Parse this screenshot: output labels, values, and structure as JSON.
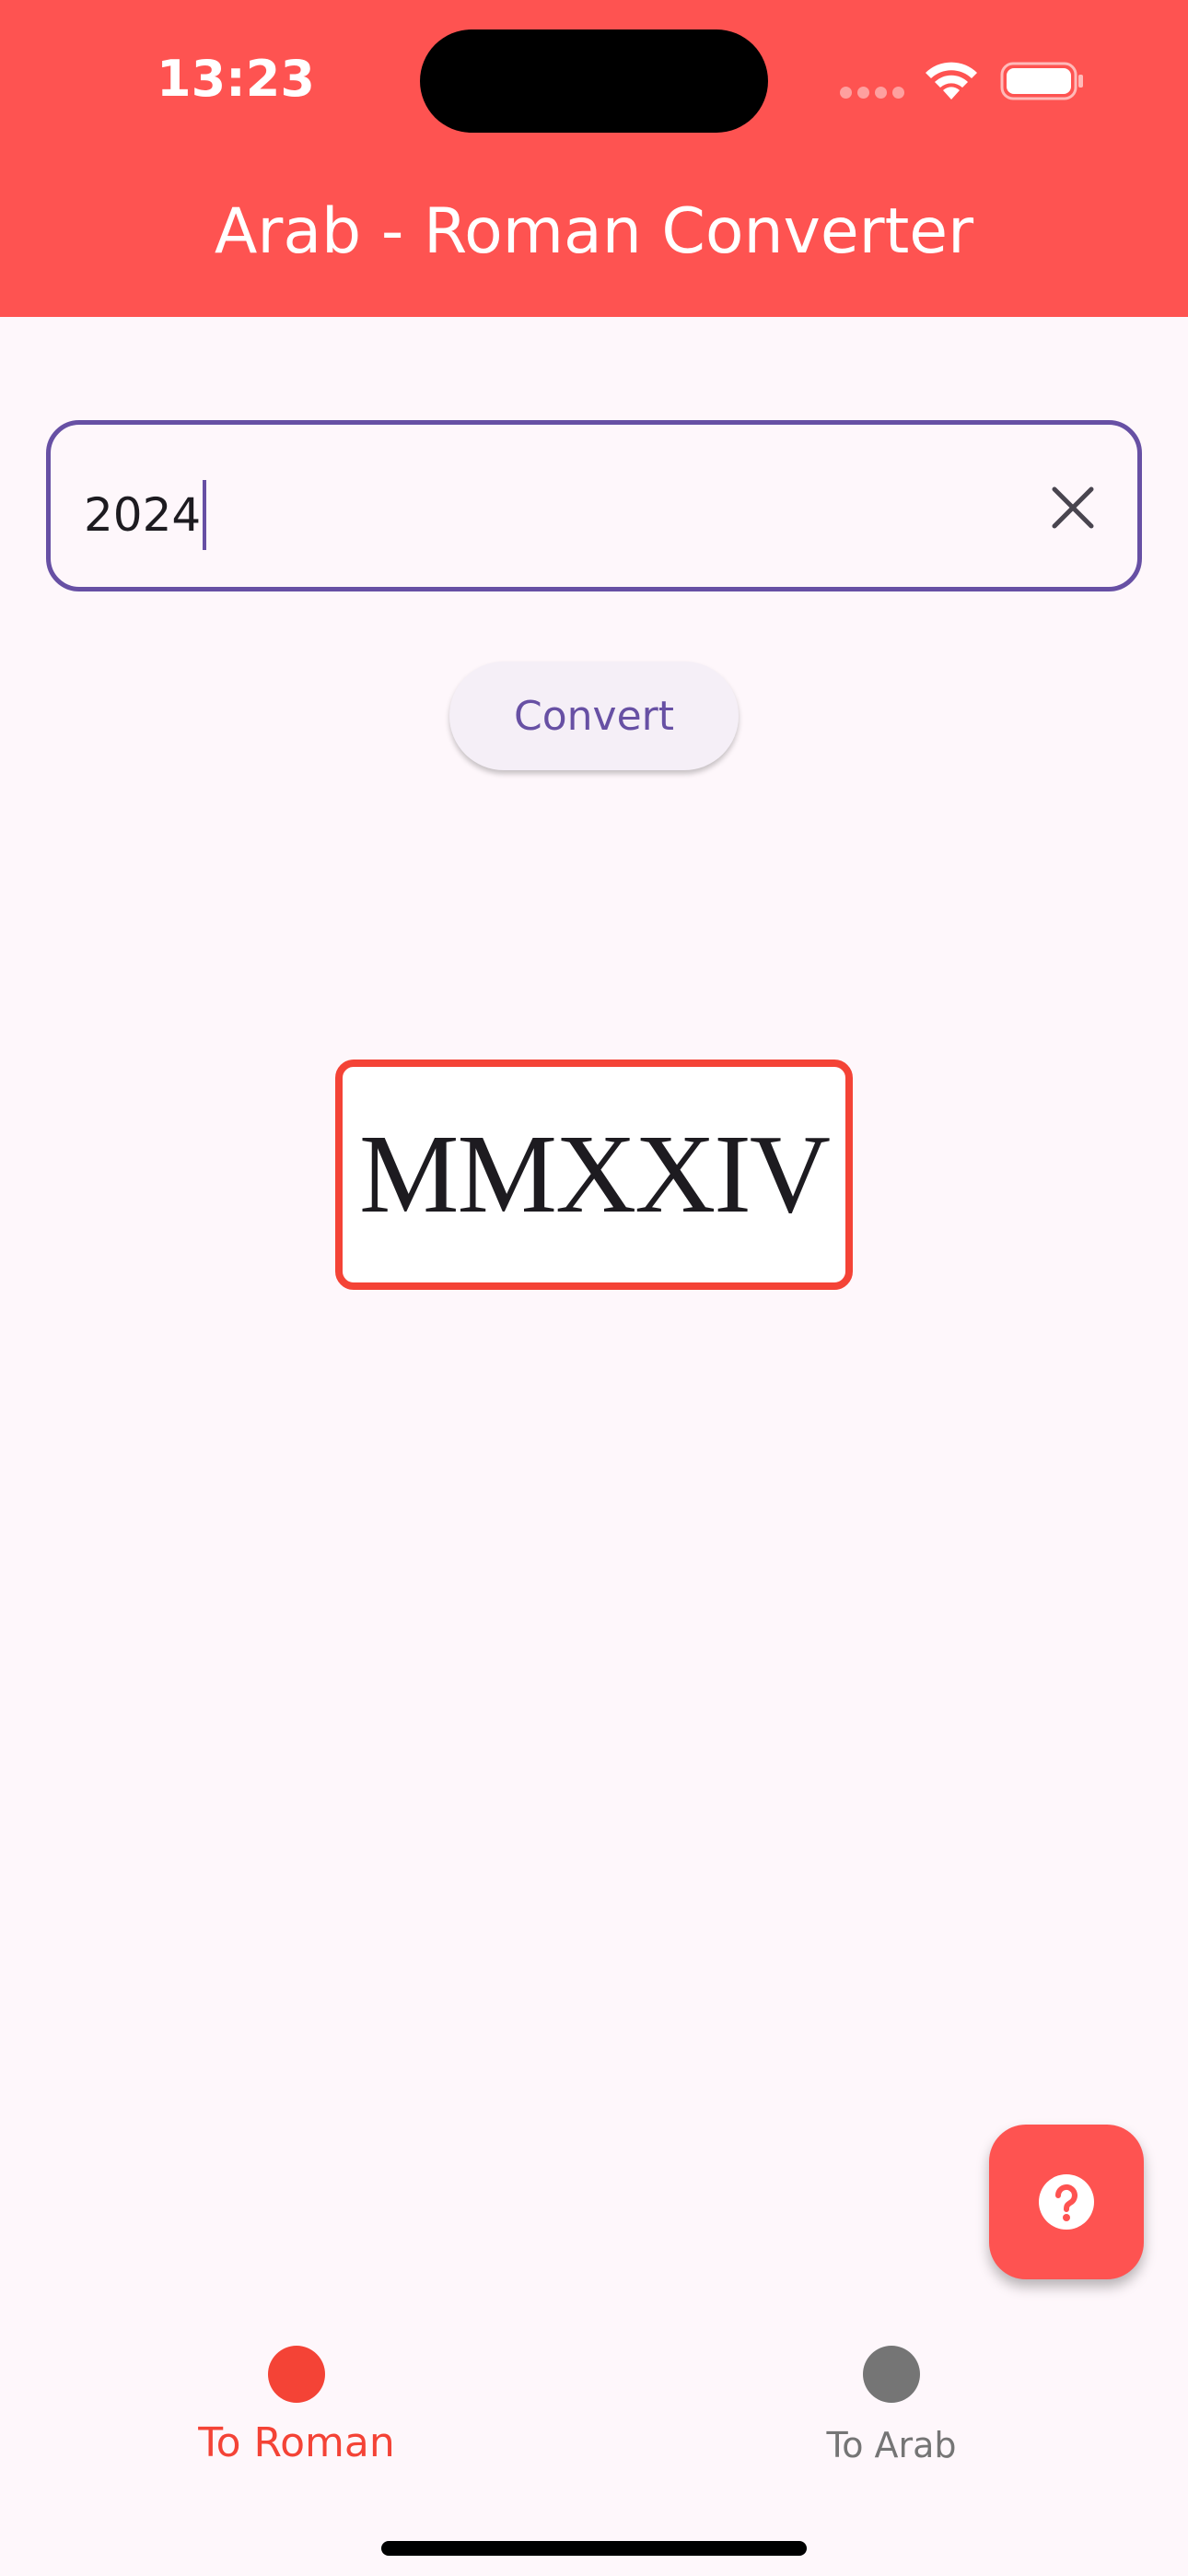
{
  "status_bar": {
    "time": "13:23"
  },
  "app_bar": {
    "title": "Arab - Roman Converter"
  },
  "input": {
    "value": "2024",
    "clear_icon": "close-icon"
  },
  "convert_button": {
    "label": "Convert"
  },
  "result": {
    "text": "MMXXIV"
  },
  "fab": {
    "icon": "help-icon"
  },
  "bottom_nav": {
    "items": [
      {
        "label": "To Roman",
        "selected": true
      },
      {
        "label": "To Arab",
        "selected": false
      }
    ]
  },
  "colors": {
    "primary": "#fe5351",
    "accent_red": "#f44336",
    "purple": "#6750a4",
    "inactive_gray": "#757575",
    "background": "#fef7fb"
  }
}
